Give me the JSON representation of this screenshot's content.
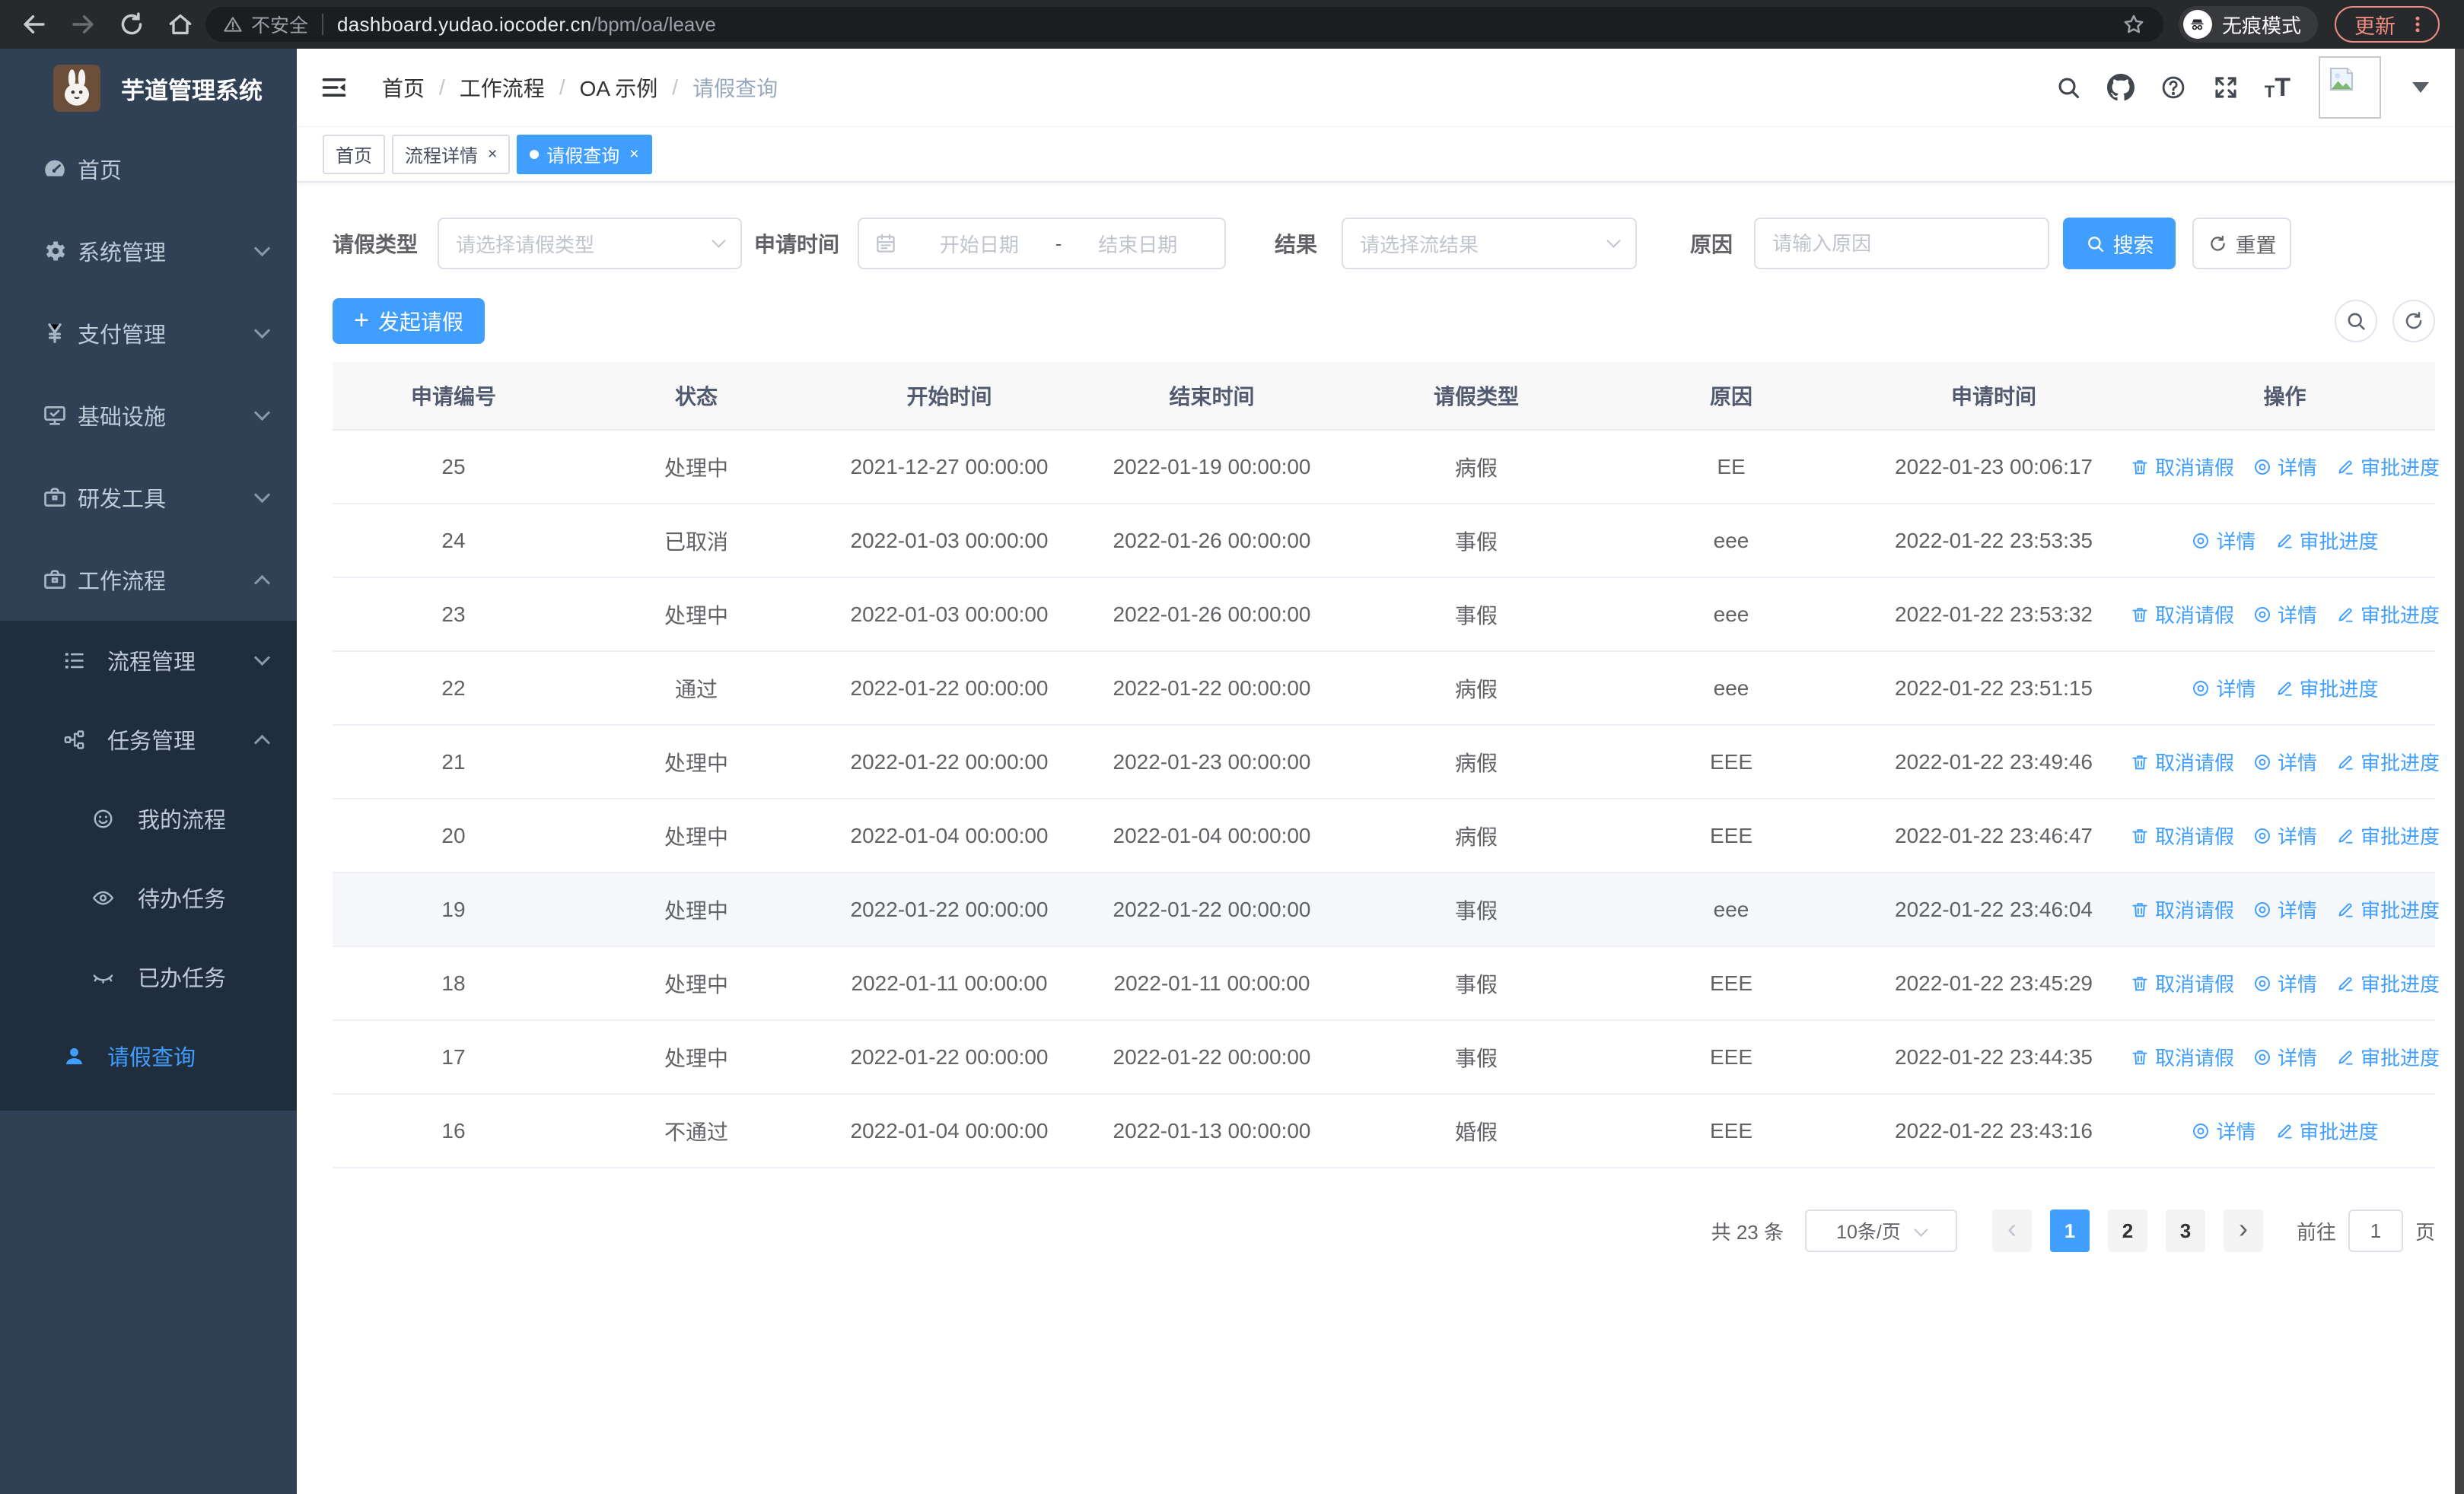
{
  "colors": {
    "accent": "#409eff",
    "sidebar_bg": "#304156",
    "submenu_bg": "#1f2d3d",
    "sidebar_text": "#bfcbd9",
    "update_accent": "#ee8d82",
    "table_header_bg": "#f8f8f9"
  },
  "browser": {
    "security_label": "不安全",
    "url_host": "dashboard.yudao.iocoder.cn",
    "url_path": "/bpm/oa/leave",
    "incognito_label": "无痕模式",
    "update_label": "更新"
  },
  "sidebar": {
    "title": "芋道管理系统",
    "menu": [
      {
        "key": "home",
        "label": "首页",
        "icon": "dashboard-icon",
        "level": 1
      },
      {
        "key": "system",
        "label": "系统管理",
        "icon": "gear-icon",
        "level": 1,
        "chevron": "down"
      },
      {
        "key": "payment",
        "label": "支付管理",
        "icon": "yen-icon",
        "level": 1,
        "chevron": "down"
      },
      {
        "key": "infrastructure",
        "label": "基础设施",
        "icon": "monitor-icon",
        "level": 1,
        "chevron": "down"
      },
      {
        "key": "dev-tools",
        "label": "研发工具",
        "icon": "toolbox-icon",
        "level": 1,
        "chevron": "down"
      },
      {
        "key": "workflow",
        "label": "工作流程",
        "icon": "briefcase-icon",
        "level": 1,
        "chevron": "up"
      }
    ],
    "submenu": [
      {
        "key": "process-mgmt",
        "label": "流程管理",
        "icon": "list-icon",
        "level": 2,
        "chevron": "down"
      },
      {
        "key": "task-mgmt",
        "label": "任务管理",
        "icon": "tree-icon",
        "level": 2,
        "chevron": "up"
      },
      {
        "key": "my-process",
        "label": "我的流程",
        "icon": "face-icon",
        "level": 3
      },
      {
        "key": "todo-tasks",
        "label": "待办任务",
        "icon": "eye-icon",
        "level": 3
      },
      {
        "key": "done-tasks",
        "label": "已办任务",
        "icon": "eye-closed-icon",
        "level": 3
      },
      {
        "key": "leave-query",
        "label": "请假查询",
        "icon": "user-icon",
        "level": 2,
        "active": true
      }
    ]
  },
  "navbar": {
    "breadcrumb": [
      "首页",
      "工作流程",
      "OA 示例",
      "请假查询"
    ],
    "icons": [
      "search-icon",
      "github-icon",
      "help-icon",
      "fullscreen-icon",
      "font-size-icon"
    ]
  },
  "tabs": [
    {
      "key": "home",
      "label": "首页",
      "closable": false,
      "active": false
    },
    {
      "key": "process-detail",
      "label": "流程详情",
      "closable": true,
      "active": false
    },
    {
      "key": "leave-query",
      "label": "请假查询",
      "closable": true,
      "active": true
    }
  ],
  "filters": {
    "leave_type_label": "请假类型",
    "leave_type_placeholder": "请选择请假类型",
    "apply_time_label": "申请时间",
    "start_placeholder": "开始日期",
    "range_separator": "-",
    "end_placeholder": "结束日期",
    "result_label": "结果",
    "result_placeholder": "请选择流结果",
    "reason_label": "原因",
    "reason_placeholder": "请输入原因",
    "search_label": "搜索",
    "reset_label": "重置"
  },
  "toolbar": {
    "create_label": "发起请假"
  },
  "table": {
    "headers": [
      "申请编号",
      "状态",
      "开始时间",
      "结束时间",
      "请假类型",
      "原因",
      "申请时间",
      "操作"
    ],
    "action_labels": {
      "cancel": "取消请假",
      "detail": "详情",
      "progress": "审批进度"
    },
    "rows": [
      {
        "id": "25",
        "status": "处理中",
        "start": "2021-12-27 00:00:00",
        "end": "2022-01-19 00:00:00",
        "type": "病假",
        "reason": "EE",
        "applied": "2022-01-23 00:06:17",
        "actions": [
          "cancel",
          "detail",
          "progress"
        ],
        "hover": false
      },
      {
        "id": "24",
        "status": "已取消",
        "start": "2022-01-03 00:00:00",
        "end": "2022-01-26 00:00:00",
        "type": "事假",
        "reason": "eee",
        "applied": "2022-01-22 23:53:35",
        "actions": [
          "detail",
          "progress"
        ],
        "hover": false
      },
      {
        "id": "23",
        "status": "处理中",
        "start": "2022-01-03 00:00:00",
        "end": "2022-01-26 00:00:00",
        "type": "事假",
        "reason": "eee",
        "applied": "2022-01-22 23:53:32",
        "actions": [
          "cancel",
          "detail",
          "progress"
        ],
        "hover": false
      },
      {
        "id": "22",
        "status": "通过",
        "start": "2022-01-22 00:00:00",
        "end": "2022-01-22 00:00:00",
        "type": "病假",
        "reason": "eee",
        "applied": "2022-01-22 23:51:15",
        "actions": [
          "detail",
          "progress"
        ],
        "hover": false
      },
      {
        "id": "21",
        "status": "处理中",
        "start": "2022-01-22 00:00:00",
        "end": "2022-01-23 00:00:00",
        "type": "病假",
        "reason": "EEE",
        "applied": "2022-01-22 23:49:46",
        "actions": [
          "cancel",
          "detail",
          "progress"
        ],
        "hover": false
      },
      {
        "id": "20",
        "status": "处理中",
        "start": "2022-01-04 00:00:00",
        "end": "2022-01-04 00:00:00",
        "type": "病假",
        "reason": "EEE",
        "applied": "2022-01-22 23:46:47",
        "actions": [
          "cancel",
          "detail",
          "progress"
        ],
        "hover": false
      },
      {
        "id": "19",
        "status": "处理中",
        "start": "2022-01-22 00:00:00",
        "end": "2022-01-22 00:00:00",
        "type": "事假",
        "reason": "eee",
        "applied": "2022-01-22 23:46:04",
        "actions": [
          "cancel",
          "detail",
          "progress"
        ],
        "hover": true
      },
      {
        "id": "18",
        "status": "处理中",
        "start": "2022-01-11 00:00:00",
        "end": "2022-01-11 00:00:00",
        "type": "事假",
        "reason": "EEE",
        "applied": "2022-01-22 23:45:29",
        "actions": [
          "cancel",
          "detail",
          "progress"
        ],
        "hover": false
      },
      {
        "id": "17",
        "status": "处理中",
        "start": "2022-01-22 00:00:00",
        "end": "2022-01-22 00:00:00",
        "type": "事假",
        "reason": "EEE",
        "applied": "2022-01-22 23:44:35",
        "actions": [
          "cancel",
          "detail",
          "progress"
        ],
        "hover": false
      },
      {
        "id": "16",
        "status": "不通过",
        "start": "2022-01-04 00:00:00",
        "end": "2022-01-13 00:00:00",
        "type": "婚假",
        "reason": "EEE",
        "applied": "2022-01-22 23:43:16",
        "actions": [
          "detail",
          "progress"
        ],
        "hover": false
      }
    ]
  },
  "pagination": {
    "total_label": "共 23 条",
    "page_size_label": "10条/页",
    "pages": [
      "1",
      "2",
      "3"
    ],
    "active_page": "1",
    "goto_label": "前往",
    "goto_value": "1",
    "unit_label": "页"
  }
}
